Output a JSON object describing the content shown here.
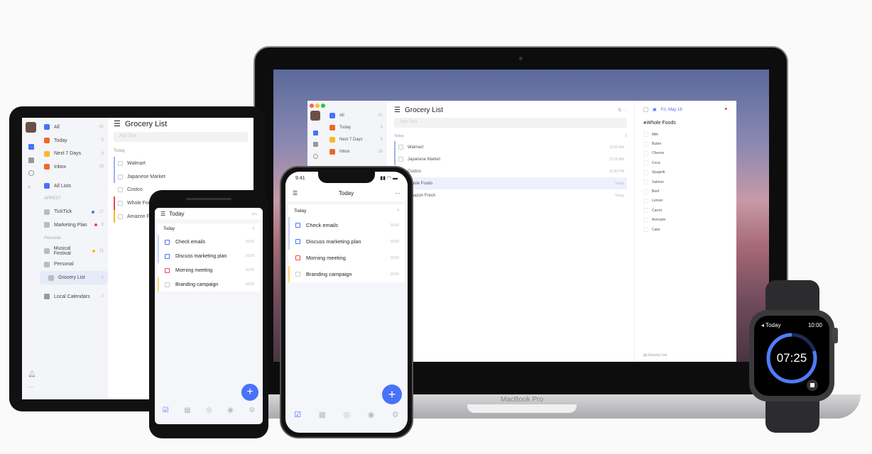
{
  "colors": {
    "accent": "#4772fa",
    "red": "#e5484d",
    "orange": "#f0672b",
    "yellow": "#f7b928"
  },
  "mac": {
    "brand": "MacBook Pro",
    "sidebar": [
      {
        "icon": "all-icon",
        "label": "All",
        "count": "42",
        "color": "#4772fa"
      },
      {
        "icon": "today-icon",
        "label": "Today",
        "count": "5",
        "color": "#f0672b"
      },
      {
        "icon": "next7-icon",
        "label": "Next 7 Days",
        "count": "5",
        "color": "#f7b928"
      },
      {
        "icon": "inbox-icon",
        "label": "Inbox",
        "count": "28",
        "color": "#f0672b"
      }
    ],
    "title": "Grocery List",
    "add_placeholder": "Add Task",
    "section": "Today",
    "section_count": "5",
    "tasks": [
      {
        "label": "Walmart",
        "time": "10:00 AM"
      },
      {
        "label": "Japanese Market",
        "time": "12:00 AM"
      },
      {
        "label": "Costco",
        "time": "10:00 PM"
      },
      {
        "label": "Whole Foods",
        "time": "Today"
      },
      {
        "label": "Amazon Fresh",
        "time": "Today"
      }
    ],
    "detail": {
      "date": "Fri, May 18",
      "title": "Whole Foods",
      "items": [
        "Milk",
        "Butter",
        "Cheese",
        "Coca",
        "Spagetti",
        "Salmon",
        "Beef",
        "Lemon",
        "Carrot",
        "Avocado",
        "Cake"
      ],
      "footer": "Grocery List"
    }
  },
  "tablet": {
    "sidebar": [
      {
        "label": "All",
        "count": "42",
        "color": "#4772fa"
      },
      {
        "label": "Today",
        "count": "5",
        "color": "#f0672b"
      },
      {
        "label": "Next 7 Days",
        "count": "9",
        "color": "#f7b928"
      },
      {
        "label": "Inbox",
        "count": "28",
        "color": "#f0672b"
      }
    ],
    "all_lists": "All Lists",
    "group1": "APPEST",
    "lists1": [
      {
        "label": "TickTick",
        "count": "17",
        "dot": "#4772fa"
      },
      {
        "label": "Marketing Plan",
        "count": "8",
        "dot": "#e5484d"
      }
    ],
    "group2": "Personal",
    "lists2": [
      {
        "label": "Musical Festival",
        "count": "11",
        "dot": "#f7b928"
      },
      {
        "label": "Personal",
        "count": ""
      }
    ],
    "active": {
      "label": "Grocery List",
      "count": "5"
    },
    "calendars": {
      "label": "Local Calendars",
      "count": "2"
    },
    "title": "Grocery List",
    "add_placeholder": "Add Task",
    "section": "Today",
    "tasks": [
      {
        "label": "Walmart",
        "bar": "#9fb3f5"
      },
      {
        "label": "Japanese Market",
        "bar": "#9fb3f5"
      },
      {
        "label": "Costco",
        "bar": ""
      },
      {
        "label": "Whole Foods",
        "bar": "#e5484d"
      },
      {
        "label": "Amazon Fresh",
        "bar": "#f7b928"
      }
    ]
  },
  "phone_tasks": [
    {
      "label": "Check emails",
      "time": "16:00",
      "color": "#4772fa"
    },
    {
      "label": "Discuss marketing plan",
      "time": "16:00",
      "color": "#4772fa"
    },
    {
      "label": "Morning meeting",
      "time": "16:00",
      "color": "#e5484d"
    },
    {
      "label": "Branding campaign",
      "time": "16:00",
      "color": "#f7b928"
    }
  ],
  "android": {
    "title": "Today",
    "section": "Today",
    "count": "4"
  },
  "iphone": {
    "clock": "9:41",
    "title": "Today",
    "section": "Today",
    "count": "4"
  },
  "watch": {
    "back": "Today",
    "clock": "10:00",
    "timer": "07:25",
    "progress": 0.8
  }
}
